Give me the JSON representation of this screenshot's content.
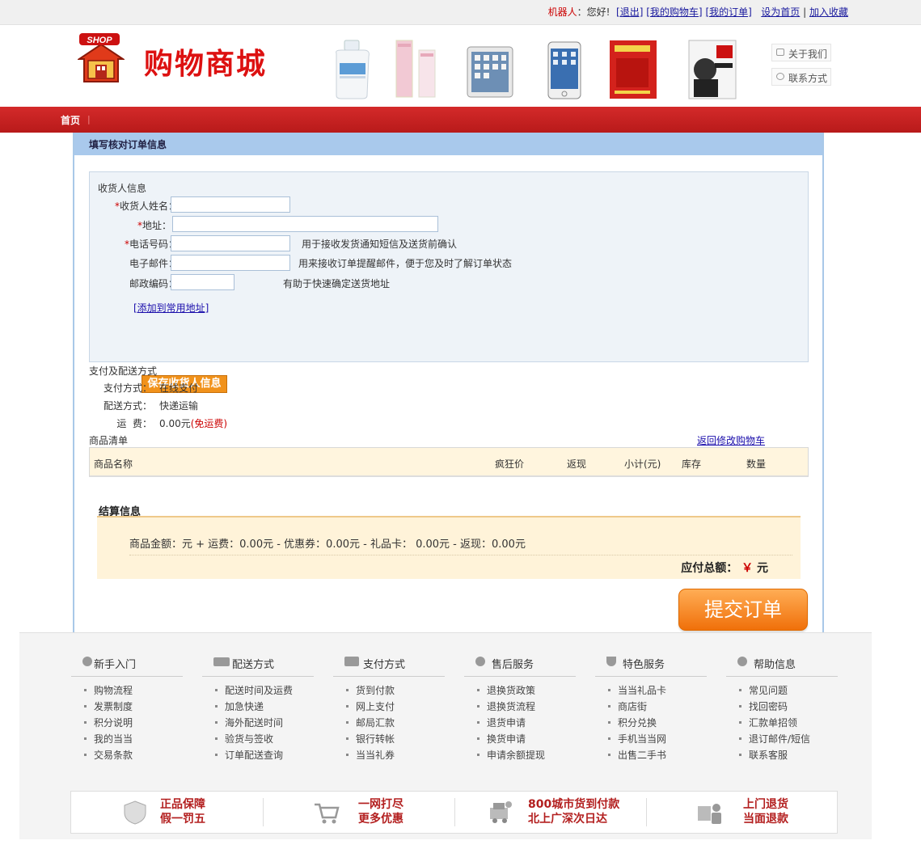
{
  "topbar": {
    "user": "机器人",
    "greeting": "：您好!",
    "logout": "[退出]",
    "cart": "[我的购物车]",
    "orders": "[我的订单]",
    "set_home": "设为首页",
    "separator": "|",
    "favorite": "加入收藏"
  },
  "header": {
    "logo_badge": "SHOP",
    "logo_text": "购物商城",
    "about": "关于我们",
    "contact": "联系方式"
  },
  "nav": {
    "home": "首页",
    "separator": "|"
  },
  "page": {
    "title": "填写核对订单信息",
    "receiver": {
      "section_title": "收货人信息",
      "name_label": "收货人姓名：",
      "address_label": "地址：",
      "phone_label": "电话号码：",
      "phone_hint": "用于接收发货通知短信及送货前确认",
      "email_label": "电子邮件：",
      "email_hint": "用来接收订单提醒邮件，便于您及时了解订单状态",
      "zip_label": "邮政编码：",
      "zip_hint": "有助于快速确定送货地址",
      "add_address_link": "[添加到常用地址]",
      "save_button": "保存收货人信息",
      "required_mark": "*"
    },
    "payment": {
      "section_title": "支付及配送方式",
      "pay_label": "支付方式：",
      "pay_value": "在线支付",
      "ship_label": "配送方式：",
      "ship_value": "快递运输",
      "fee_label": "运  费：",
      "fee_value": "0.00元",
      "fee_note": "(免运费)"
    },
    "goods": {
      "section_title": "商品清单",
      "back_link": "返回修改购物车",
      "columns": [
        "商品名称",
        "疯狂价",
        "返现",
        "小计(元)",
        "库存",
        "数量"
      ]
    },
    "settlement": {
      "title": "结算信息",
      "line": "商品金额：元 + 运费：0.00元 - 优惠券：0.00元 - 礼品卡： 0.00元 - 返现：0.00元",
      "total_label": "应付总额：",
      "currency": "￥",
      "unit": " 元"
    },
    "submit_button": "提交订单"
  },
  "footer": {
    "columns": [
      {
        "title": "新手入门",
        "items": [
          "购物流程",
          "发票制度",
          "积分说明",
          "我的当当",
          "交易条款"
        ]
      },
      {
        "title": "配送方式",
        "items": [
          "配送时间及运费",
          "加急快递",
          "海外配送时间",
          "验货与签收",
          "订单配送查询"
        ]
      },
      {
        "title": "支付方式",
        "items": [
          "货到付款",
          "网上支付",
          "邮局汇款",
          "银行转帐",
          "当当礼券"
        ]
      },
      {
        "title": "售后服务",
        "items": [
          "退换货政策",
          "退换货流程",
          "退货申请",
          "换货申请",
          "申请余额提现"
        ]
      },
      {
        "title": "特色服务",
        "items": [
          "当当礼品卡",
          "商店街",
          "积分兑换",
          "手机当当网",
          "出售二手书"
        ]
      },
      {
        "title": "帮助信息",
        "items": [
          "常见问题",
          "找回密码",
          "汇款单招领",
          "退订邮件/短信",
          "联系客服"
        ]
      }
    ],
    "guarantees": [
      {
        "line1": "正品保障",
        "line2": "假一罚五"
      },
      {
        "line1": "一网打尽",
        "line2": "更多优惠"
      },
      {
        "line1": "800城市货到付款",
        "line2": "北上广深次日达"
      },
      {
        "line1": "上门退货",
        "line2": "当面退款"
      }
    ]
  }
}
